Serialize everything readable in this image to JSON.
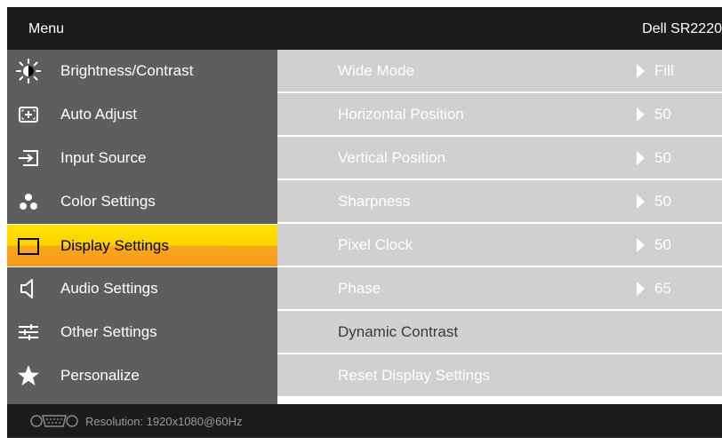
{
  "header": {
    "title": "Menu",
    "model": "Dell SR2220"
  },
  "sidebar": {
    "items": [
      {
        "label": "Brightness/Contrast",
        "icon": "brightness-icon"
      },
      {
        "label": "Auto Adjust",
        "icon": "auto-adjust-icon"
      },
      {
        "label": "Input Source",
        "icon": "input-source-icon"
      },
      {
        "label": "Color Settings",
        "icon": "color-settings-icon"
      },
      {
        "label": "Display Settings",
        "icon": "display-icon",
        "active": true
      },
      {
        "label": "Audio Settings",
        "icon": "speaker-icon"
      },
      {
        "label": "Other Settings",
        "icon": "sliders-icon"
      },
      {
        "label": "Personalize",
        "icon": "star-icon"
      }
    ]
  },
  "settings": {
    "rows": [
      {
        "label": "Wide Mode",
        "value": "Fill"
      },
      {
        "label": "Horizontal Position",
        "value": "50"
      },
      {
        "label": "Vertical Position",
        "value": "50"
      },
      {
        "label": "Sharpness",
        "value": "50"
      },
      {
        "label": "Pixel Clock",
        "value": "50"
      },
      {
        "label": "Phase",
        "value": "65"
      },
      {
        "label": "Dynamic Contrast"
      },
      {
        "label": "Reset Display Settings"
      }
    ]
  },
  "footer": {
    "connector_icon": "vga-connector-icon",
    "resolution": "Resolution:  1920x1080@60Hz"
  },
  "colors": {
    "highlight": "#ffd000",
    "sidebar_bg": "#5e5e5e",
    "row_bg": "#d0d0d0",
    "frame_bg": "#1c1c1c"
  }
}
